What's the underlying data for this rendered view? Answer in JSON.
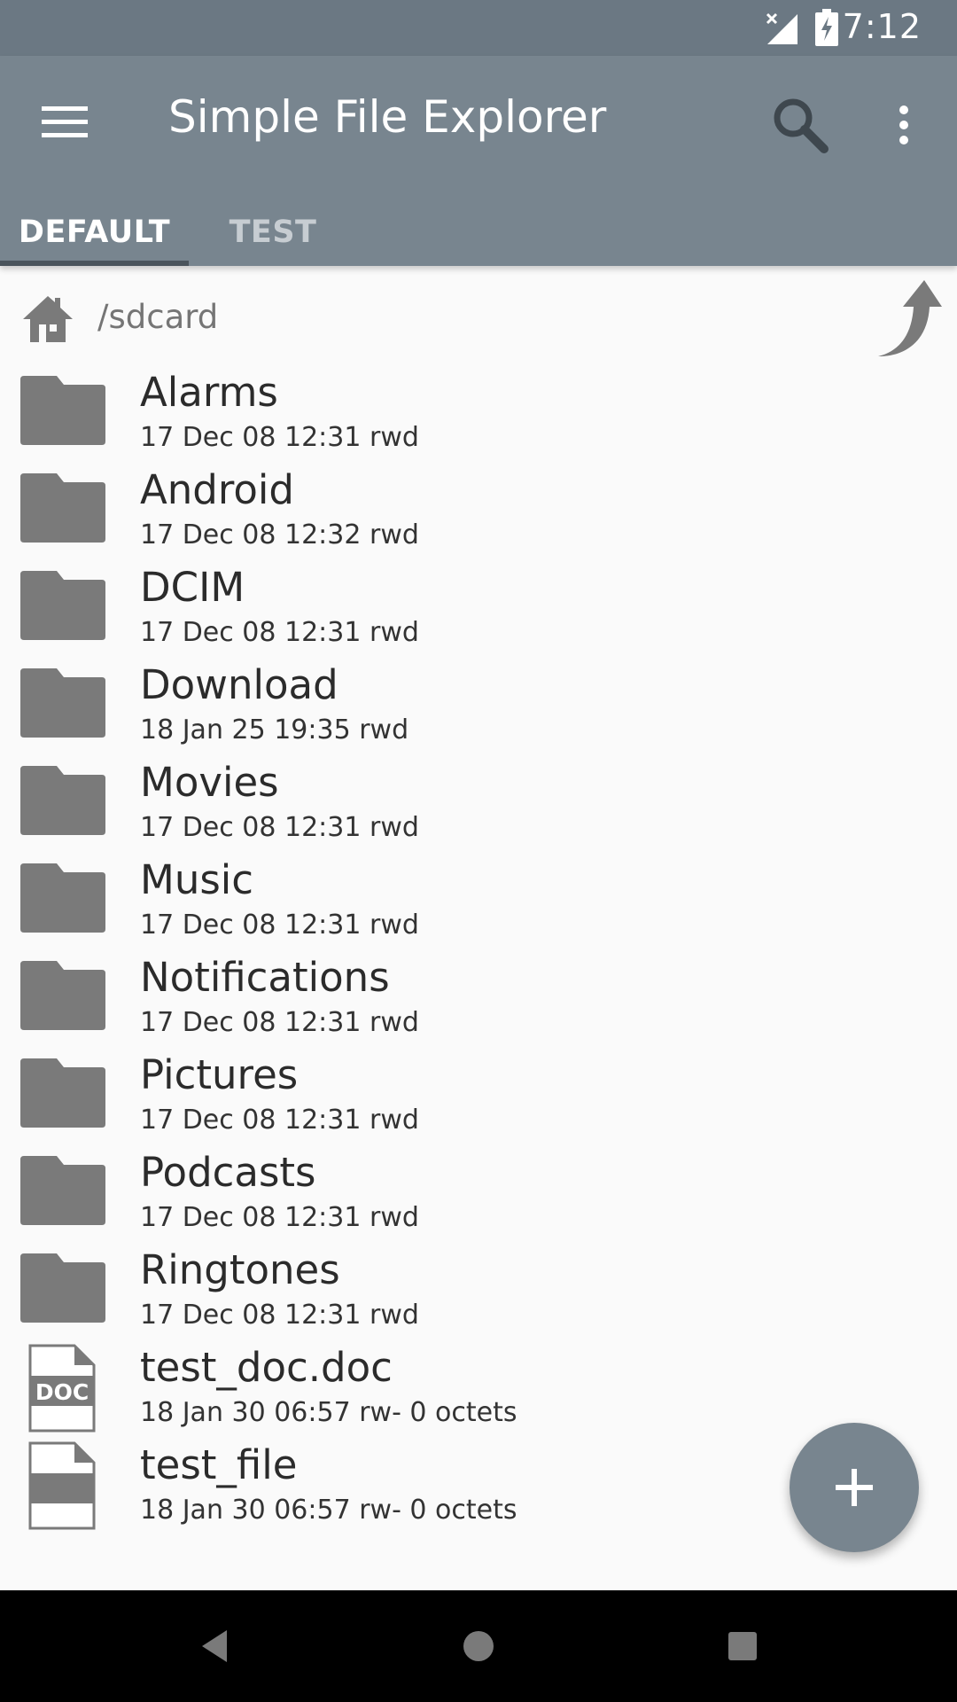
{
  "status_bar": {
    "time": "7:12"
  },
  "app_bar": {
    "title": "Simple File Explorer",
    "icons": {
      "menu": "menu-icon",
      "search": "search-icon",
      "more": "more-vert-icon"
    }
  },
  "tabs": [
    {
      "label": "DEFAULT",
      "selected": true
    },
    {
      "label": "TEST",
      "selected": false
    }
  ],
  "path_bar": {
    "path": "/sdcard"
  },
  "files": [
    {
      "type": "folder",
      "name": "Alarms",
      "meta": "17 Dec 08 12:31 rwd"
    },
    {
      "type": "folder",
      "name": "Android",
      "meta": "17 Dec 08 12:32 rwd"
    },
    {
      "type": "folder",
      "name": "DCIM",
      "meta": "17 Dec 08 12:31 rwd"
    },
    {
      "type": "folder",
      "name": "Download",
      "meta": "18 Jan 25 19:35 rwd"
    },
    {
      "type": "folder",
      "name": "Movies",
      "meta": "17 Dec 08 12:31 rwd"
    },
    {
      "type": "folder",
      "name": "Music",
      "meta": "17 Dec 08 12:31 rwd"
    },
    {
      "type": "folder",
      "name": "Notifications",
      "meta": "17 Dec 08 12:31 rwd"
    },
    {
      "type": "folder",
      "name": "Pictures",
      "meta": "17 Dec 08 12:31 rwd"
    },
    {
      "type": "folder",
      "name": "Podcasts",
      "meta": "17 Dec 08 12:31 rwd"
    },
    {
      "type": "folder",
      "name": "Ringtones",
      "meta": "17 Dec 08 12:31 rwd"
    },
    {
      "type": "doc",
      "name": "test_doc.doc",
      "meta": "18 Jan 30 06:57 rw-  0 octets",
      "badge": "DOC"
    },
    {
      "type": "file",
      "name": "test_file",
      "meta": "18 Jan 30 06:57 rw-  0 octets"
    }
  ],
  "colors": {
    "primary": "#78858f",
    "primary_dark": "#6b7883",
    "icon_gray": "#7a7a7a"
  }
}
